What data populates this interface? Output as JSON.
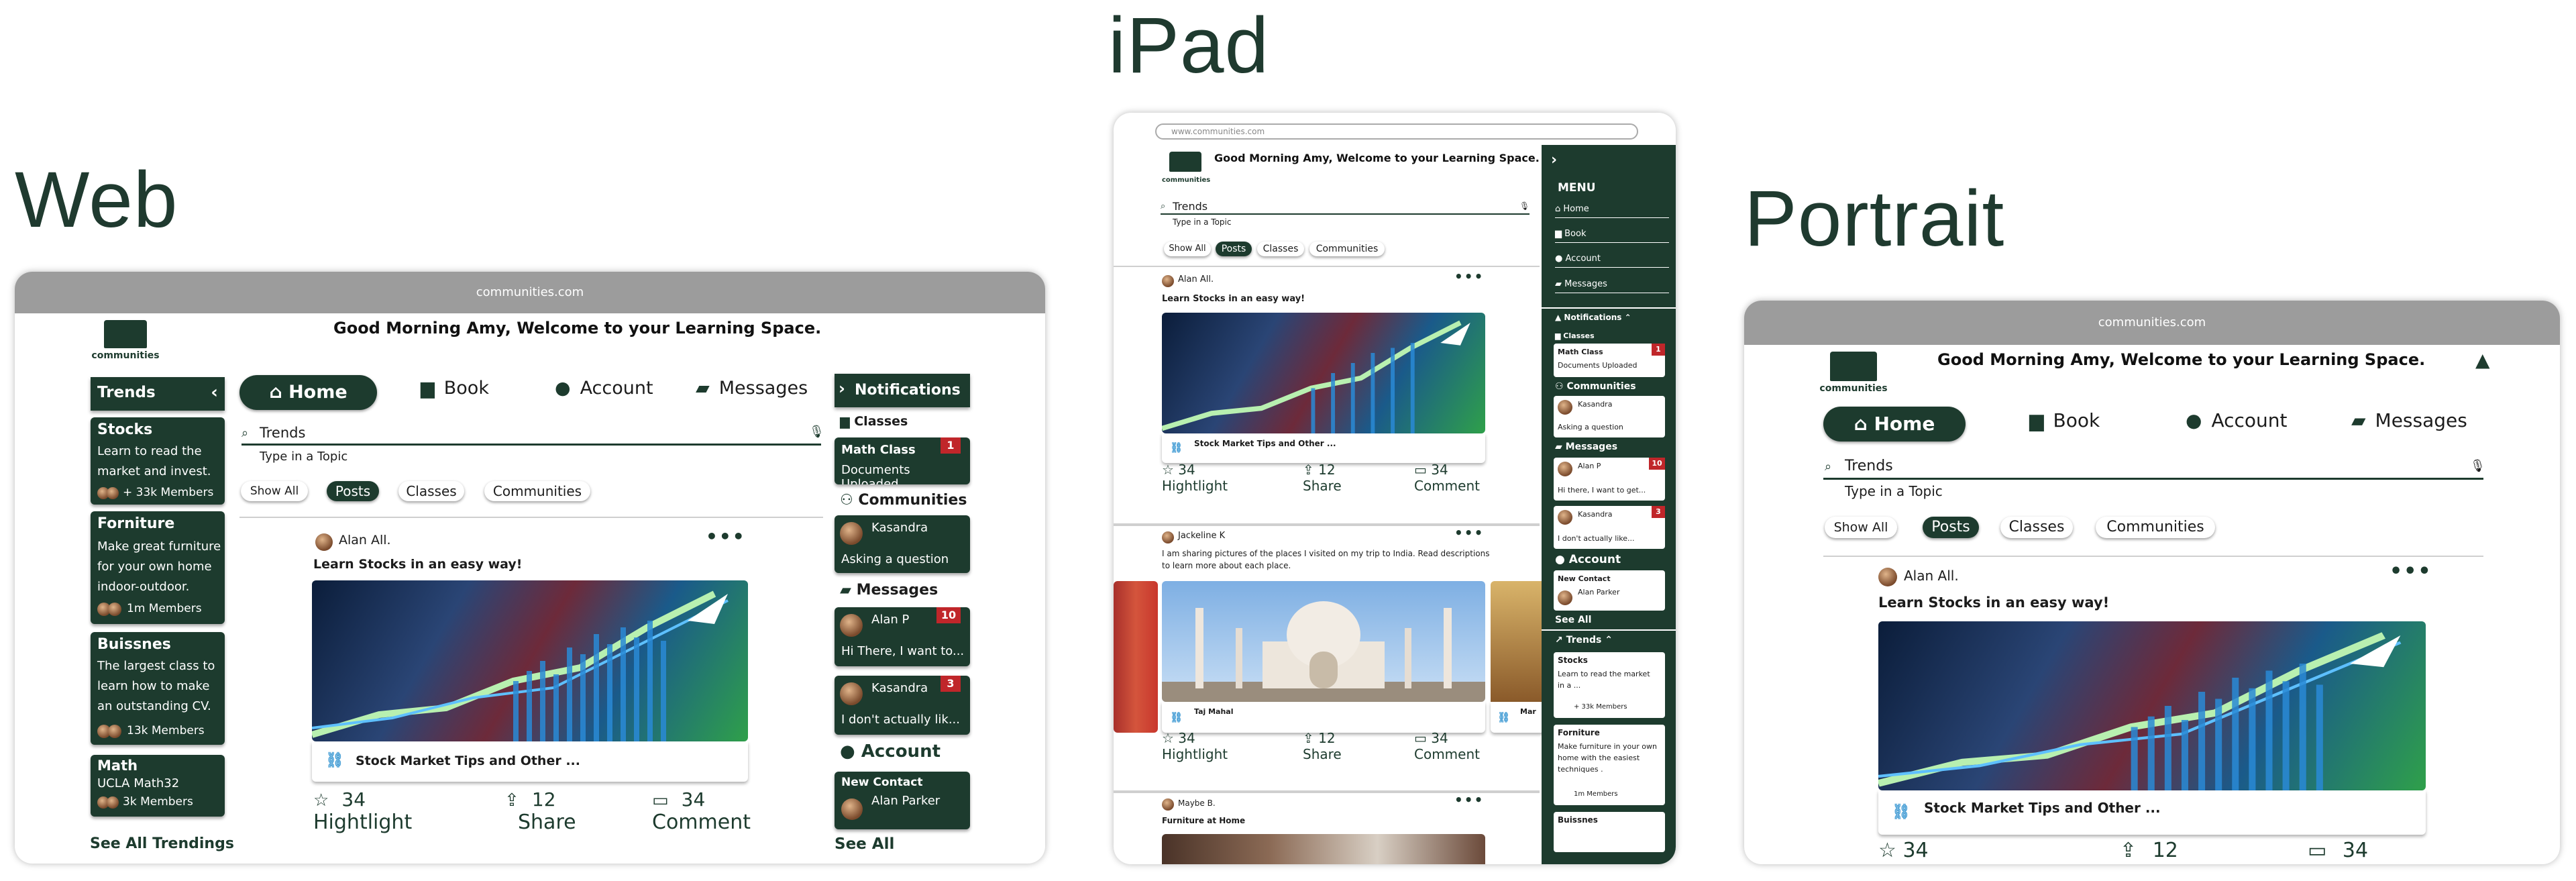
{
  "titles": {
    "web": "Web",
    "ipad": "iPad",
    "portrait": "Portrait"
  },
  "url": "communities.com",
  "ipad_url": "www.communities.com",
  "logo_text": "communities",
  "greeting": "Good Morning Amy, Welcome to your Learning Space.",
  "nav": {
    "home": "Home",
    "book": "Book",
    "account": "Account",
    "messages": "Messages"
  },
  "search": {
    "value": "Trends",
    "hint": "Type in a Topic"
  },
  "filters": [
    "Show All",
    "Posts",
    "Classes",
    "Communities"
  ],
  "trends": {
    "header": "Trends",
    "see_all": "See All Trendings",
    "items": [
      {
        "title": "Stocks",
        "desc": "Learn to read the market and invest.",
        "members": "+ 33k Members"
      },
      {
        "title": "Forniture",
        "desc": "Make great furniture for your own home indoor-outdoor.",
        "members": "1m Members"
      },
      {
        "title": "Buissnes",
        "desc": "The largest class to learn how to make an outstanding CV.",
        "members": "13k Members"
      },
      {
        "title": "Math",
        "desc": "UCLA Math32",
        "members": "3k Members"
      }
    ]
  },
  "notifications": {
    "header": "Notifications",
    "classes": "Classes",
    "class_title": "Math Class",
    "class_desc": "Documents Uploaded",
    "class_badge": "1",
    "communities": "Communities",
    "comm_name": "Kasandra",
    "comm_desc": "Asking a question",
    "messages": "Messages",
    "msg1_name": "Alan P",
    "msg1_text": "Hi There, I want to...",
    "msg1_badge": "10",
    "msg2_name": "Kasandra",
    "msg2_text": "I don't actually lik...",
    "msg2_badge": "3",
    "account": "Account",
    "contact_title": "New Contact",
    "contact_name": "Alan Parker",
    "see_all": "See All"
  },
  "post1": {
    "author": "Alan All.",
    "title": "Learn Stocks in an easy way!",
    "link": "Stock Market Tips and Other ...",
    "likes": "34",
    "likes_label": "Hightlight",
    "shares": "12",
    "shares_label": "Share",
    "comments": "34",
    "comments_label": "Comment",
    "more": "•••"
  },
  "post2": {
    "author": "Jackeline K",
    "text": "I am sharing pictures of the places I visited on my trip to India. Read descriptions to learn more about each place.",
    "link": "Taj Mahal",
    "link2": "Mar",
    "likes": "34",
    "shares": "12",
    "comments": "34"
  },
  "post3": {
    "author": "Maybe B.",
    "title": "Furniture at Home"
  },
  "ipad_menu": {
    "title": "MENU",
    "items": [
      "Home",
      "Book",
      "Account",
      "Messages"
    ],
    "notifications": "Notifications",
    "classes": "Classes",
    "class_title": "Math Class",
    "class_desc": "Documents Uploaded",
    "class_badge": "1",
    "communities": "Communities",
    "comm_name": "Kasandra",
    "comm_desc": "Asking a question",
    "messages": "Messages",
    "msg1_name": "Alan P",
    "msg1_text": "Hi there, I want to get...",
    "msg1_badge": "10",
    "msg2_name": "Kasandra",
    "msg2_text": "I don't actually like...",
    "msg2_badge": "3",
    "account": "Account",
    "contact_title": "New Contact",
    "contact_name": "Alan Parker",
    "see_all": "See All",
    "trends": "Trends",
    "t1_title": "Stocks",
    "t1_desc": "Learn to read the market in a ...",
    "t1_members": "+ 33k Members",
    "t2_title": "Forniture",
    "t2_desc": "Make furniture in your own home with the easiest techniques .",
    "t2_members": "1m Members",
    "t3_title": "Buissnes"
  }
}
